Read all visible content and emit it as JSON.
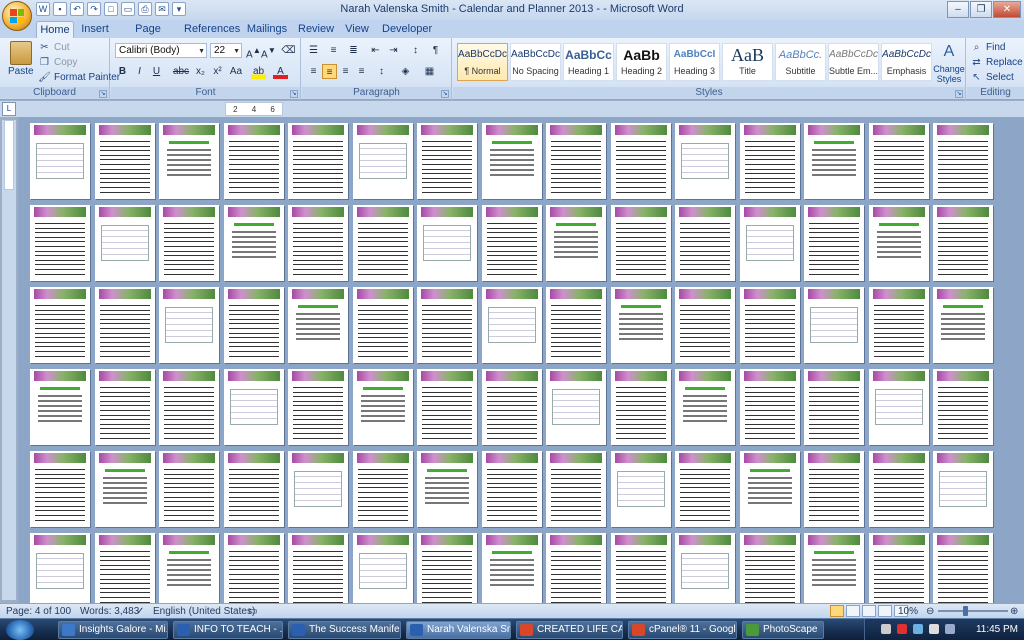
{
  "window": {
    "title": "Narah Valenska Smith - Calendar and Planner 2013 - - Microsoft Word",
    "buttons": [
      "minimize",
      "maximize",
      "close"
    ]
  },
  "quick_access": {
    "icons": [
      "word-icon",
      "save-icon",
      "undo-icon",
      "redo-icon",
      "new-icon",
      "open-icon",
      "print-icon",
      "email-icon",
      "customize-icon"
    ]
  },
  "tabs": [
    {
      "label": "Home",
      "active": true
    },
    {
      "label": "Insert"
    },
    {
      "label": "Page Layout"
    },
    {
      "label": "References"
    },
    {
      "label": "Mailings"
    },
    {
      "label": "Review"
    },
    {
      "label": "View"
    },
    {
      "label": "Developer"
    }
  ],
  "ribbon": {
    "clipboard": {
      "label": "Clipboard",
      "paste": "Paste",
      "cut": "Cut",
      "copy": "Copy",
      "format_painter": "Format Painter"
    },
    "font": {
      "label": "Font",
      "font_name": "Calibri (Body)",
      "font_size": "22",
      "buttons": [
        "B",
        "I",
        "U",
        "abc",
        "x₂",
        "x²",
        "Aa"
      ]
    },
    "paragraph": {
      "label": "Paragraph"
    },
    "styles": {
      "label": "Styles",
      "items": [
        {
          "sample": "AaBbCcDc",
          "name": "¶ Normal",
          "active": true
        },
        {
          "sample": "AaBbCcDc",
          "name": "No Spacing"
        },
        {
          "sample": "AaBbCc",
          "name": "Heading 1"
        },
        {
          "sample": "AaBb",
          "name": "Heading 2"
        },
        {
          "sample": "AaBbCcI",
          "name": "Heading 3"
        },
        {
          "sample": "AaB",
          "name": "Title"
        },
        {
          "sample": "AaBbCc.",
          "name": "Subtitle"
        },
        {
          "sample": "AaBbCcDc",
          "name": "Subtle Em..."
        },
        {
          "sample": "AaBbCcDc",
          "name": "Emphasis"
        }
      ],
      "change_styles": "Change Styles"
    },
    "editing": {
      "label": "Editing",
      "find": "Find",
      "replace": "Replace",
      "select": "Select"
    }
  },
  "ruler": {
    "marks": [
      "2",
      "4",
      "6"
    ]
  },
  "status_bar": {
    "page": "Page: 4 of 100",
    "words": "Words: 3,483",
    "language": "English (United States)",
    "zoom": "10%"
  },
  "taskbar": {
    "items": [
      {
        "label": "Insights Galore - Mi...",
        "color": "#3d79c9"
      },
      {
        "label": "INFO TO TEACH - ...",
        "color": "#2b5fb0"
      },
      {
        "label": "The Success Manife...",
        "color": "#2b5fb0"
      },
      {
        "label": "Narah Valenska Smi...",
        "color": "#2b5fb0"
      },
      {
        "label": "CREATED LIFE CALE...",
        "color": "#d6472c"
      },
      {
        "label": "cPanel® 11 - Googl...",
        "color": "#d6472c"
      },
      {
        "label": "PhotoScape",
        "color": "#4a9a3a"
      }
    ],
    "clock": "11:45 PM"
  },
  "colors": {
    "ribbon_bg": "#dbe7f6",
    "accent": "#15428b",
    "canvas_bg": "#8da5c6",
    "banner_purple": "#a74aa3",
    "banner_green": "#4f8a3e"
  }
}
